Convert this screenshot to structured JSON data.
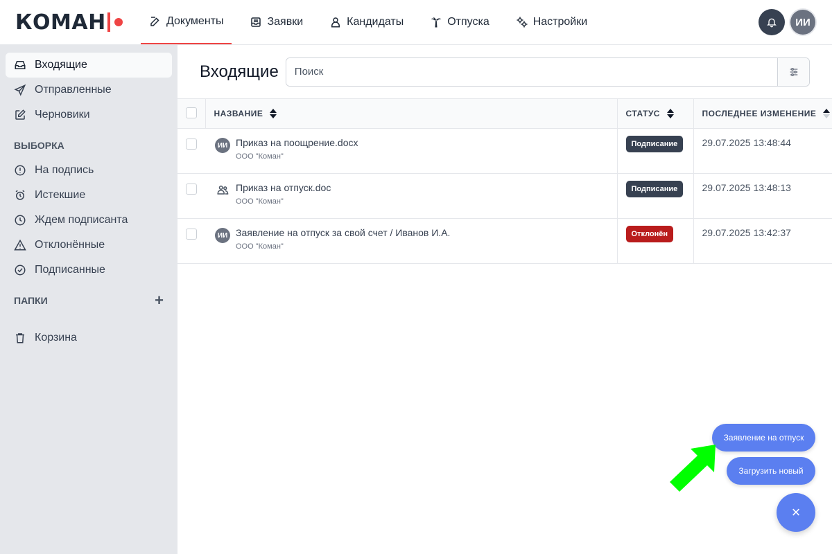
{
  "brand": {
    "name": "КОМАН"
  },
  "nav": [
    {
      "id": "docs",
      "label": "Документы",
      "icon": "document-edit-icon",
      "active": true
    },
    {
      "id": "requests",
      "label": "Заявки",
      "icon": "inbox-tray-icon"
    },
    {
      "id": "candidates",
      "label": "Кандидаты",
      "icon": "person-badge-icon"
    },
    {
      "id": "vacations",
      "label": "Отпуска",
      "icon": "palm-tree-icon"
    },
    {
      "id": "settings",
      "label": "Настройки",
      "icon": "gears-icon"
    }
  ],
  "user": {
    "initials": "ИИ"
  },
  "sidebar": {
    "main_items": [
      {
        "label": "Входящие",
        "icon": "inbox-icon",
        "active": true
      },
      {
        "label": "Отправленные",
        "icon": "paper-plane-icon"
      },
      {
        "label": "Черновики",
        "icon": "pencil-square-icon"
      }
    ],
    "selection_heading": "ВЫБОРКА",
    "selection_items": [
      {
        "label": "На подпись",
        "icon": "alert-circle-icon"
      },
      {
        "label": "Истекшие",
        "icon": "alarm-clock-icon"
      },
      {
        "label": "Ждем подписанта",
        "icon": "clock-icon"
      },
      {
        "label": "Отклонённые",
        "icon": "warning-triangle-icon"
      },
      {
        "label": "Подписанные",
        "icon": "check-circle-icon"
      }
    ],
    "folders_heading": "ПАПКИ",
    "add_folder": "+",
    "trash": {
      "label": "Корзина",
      "icon": "trash-icon"
    }
  },
  "main": {
    "title": "Входящие",
    "search_placeholder": "Поиск",
    "columns": {
      "name": "НАЗВАНИЕ",
      "status": "СТАТУС",
      "date": "ПОСЛЕДНЕЕ ИЗМЕНЕНИЕ"
    },
    "rows": [
      {
        "avatar": "ИИ",
        "type": "user",
        "title": "Приказ на поощрение.docx",
        "org": "ООО \"Коман\"",
        "status": "Подписание",
        "status_kind": "sign",
        "date": "29.07.2025 13:48:44"
      },
      {
        "avatar": "",
        "type": "group",
        "title": "Приказ на отпуск.doc",
        "org": "ООО \"Коман\"",
        "status": "Подписание",
        "status_kind": "sign",
        "date": "29.07.2025 13:48:13"
      },
      {
        "avatar": "ИИ",
        "type": "user",
        "title": "Заявление на отпуск за свой счет / Иванов И.А.",
        "org": "ООО \"Коман\"",
        "status": "Отклонён",
        "status_kind": "reject",
        "date": "29.07.2025 13:42:37"
      }
    ]
  },
  "fab": {
    "options": [
      "Заявление на отпуск",
      "Загрузить новый"
    ],
    "close": "×"
  },
  "colors": {
    "accent": "#5b7ff0",
    "brand_red": "#ef4444",
    "highlight_arrow": "#00ff00"
  }
}
